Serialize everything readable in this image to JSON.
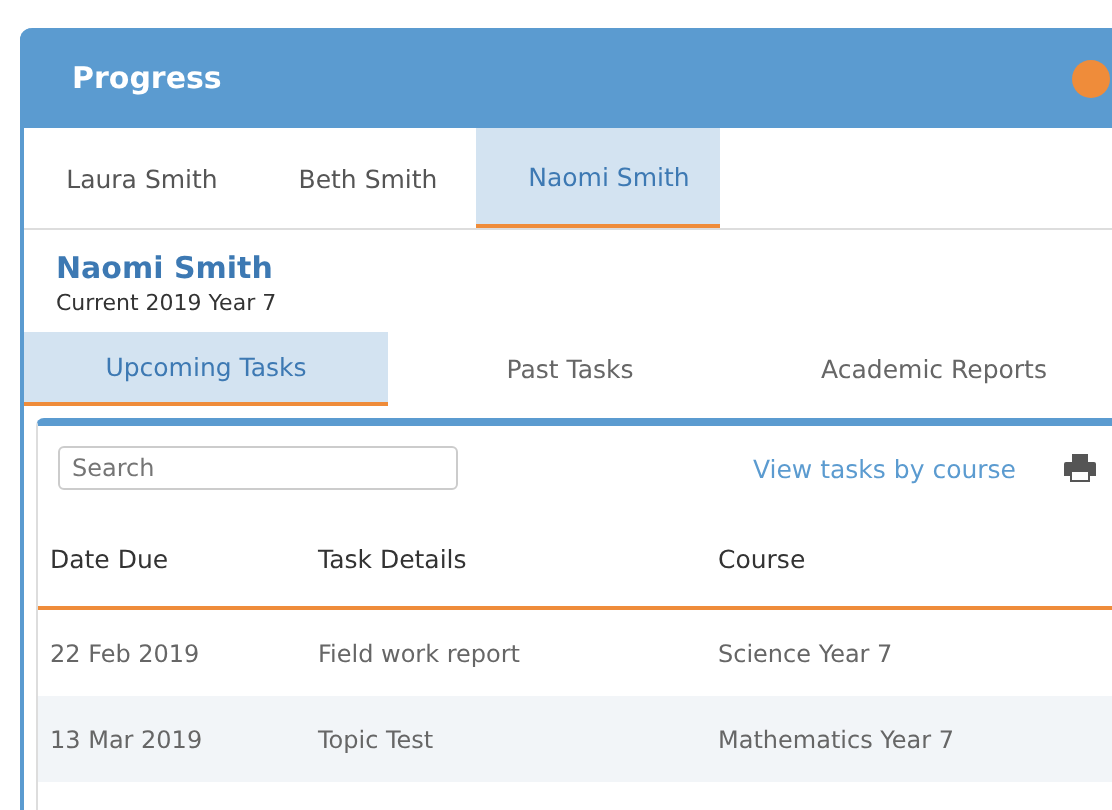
{
  "window": {
    "title": "Progress",
    "status_dot": true
  },
  "student_tabs": [
    {
      "label": "Laura Smith",
      "selected": false
    },
    {
      "label": "Beth Smith",
      "selected": false
    },
    {
      "label": "Naomi Smith",
      "selected": true
    }
  ],
  "student": {
    "name": "Naomi Smith",
    "enrolment": "Current 2019 Year 7"
  },
  "task_tabs": [
    {
      "label": "Upcoming Tasks",
      "selected": true
    },
    {
      "label": "Past Tasks",
      "selected": false
    },
    {
      "label": "Academic Reports",
      "selected": false
    }
  ],
  "search": {
    "placeholder": "Search"
  },
  "view_link": "View tasks by course",
  "table": {
    "columns": [
      "Date Due",
      "Task Details",
      "Course"
    ],
    "rows": [
      [
        "22 Feb 2019",
        "Field work report",
        "Science Year 7"
      ],
      [
        "13 Mar 2019",
        "Topic Test",
        "Mathematics Year 7"
      ]
    ]
  }
}
